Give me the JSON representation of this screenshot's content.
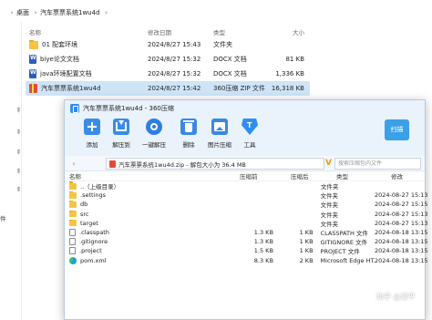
{
  "explorer": {
    "address": {
      "chevron": "›",
      "crumb1": "桌面",
      "crumb2": "汽车票票系统1wu4d"
    },
    "sidebar_fragments": [
      "",
      "",
      "",
      "",
      "",
      "件",
      "",
      "",
      "",
      "",
      "",
      "",
      "",
      "",
      ""
    ],
    "columns": {
      "name": "名称",
      "date": "修改日期",
      "type": "类型",
      "size": "大小"
    },
    "files": [
      {
        "name": "01 配套环境",
        "date": "2024/8/27 15:43",
        "type": "文件夹",
        "size": "",
        "icon": "folder-icon"
      },
      {
        "name": "biye论文文档",
        "date": "2024/8/27 15:32",
        "type": "DOCX 文档",
        "size": "81 KB",
        "icon": "docx-icon"
      },
      {
        "name": "java环境配置文档",
        "date": "2024/8/27 15:32",
        "type": "DOCX 文档",
        "size": "1,336 KB",
        "icon": "docx-icon"
      },
      {
        "name": "汽车票票系统1wu4d",
        "date": "2024/8/27 15:42",
        "type": "360压缩 ZIP 文件",
        "size": "16,318 KB",
        "icon": "zip-icon"
      }
    ]
  },
  "zip": {
    "title": "汽车票票系统1wu4d - 360压缩",
    "toolbar": [
      {
        "name": "add",
        "label": "添加",
        "icon": "add-icon"
      },
      {
        "name": "extract",
        "label": "解压到",
        "icon": "extract-icon"
      },
      {
        "name": "oneclick",
        "label": "一键解压",
        "icon": "one-click-extract-icon"
      },
      {
        "name": "delete",
        "label": "删除",
        "icon": "delete-icon"
      },
      {
        "name": "imgzip",
        "label": "图片压缩",
        "icon": "image-compress-icon"
      },
      {
        "name": "tools",
        "label": "工具",
        "icon": "tools-icon"
      }
    ],
    "badge": "扫描",
    "path": "汽车票票系统1wu4d.zip - 解包大小为 36.4 MB",
    "search_placeholder": "搜索压缩包内文件",
    "columns": {
      "name": "名称",
      "compressed": "压缩前",
      "original": "压缩后",
      "type": "类型",
      "modified": "修改"
    },
    "files": [
      {
        "name": "..（上级目录）",
        "compressed": "",
        "original": "",
        "type": "文件夹",
        "modified": "",
        "icon": "folder-icon"
      },
      {
        "name": ".settings",
        "compressed": "",
        "original": "",
        "type": "文件夹",
        "modified": "2024-08-27 15:13",
        "icon": "folder-icon"
      },
      {
        "name": "db",
        "compressed": "",
        "original": "",
        "type": "文件夹",
        "modified": "2024-08-27 15:15",
        "icon": "folder-icon"
      },
      {
        "name": "src",
        "compressed": "",
        "original": "",
        "type": "文件夹",
        "modified": "2024-08-27 15:13",
        "icon": "folder-icon"
      },
      {
        "name": "target",
        "compressed": "",
        "original": "",
        "type": "文件夹",
        "modified": "2024-08-27 15:13",
        "icon": "folder-icon"
      },
      {
        "name": ".classpath",
        "compressed": "1.3 KB",
        "original": "1 KB",
        "type": "CLASSPATH 文件",
        "modified": "2024-08-18 13:15",
        "icon": "file-icon"
      },
      {
        "name": ".gitignore",
        "compressed": "1.3 KB",
        "original": "1 KB",
        "type": "GITIGNORE 文件",
        "modified": "2024-08-18 13:15",
        "icon": "file-icon"
      },
      {
        "name": ".project",
        "compressed": "1.5 KB",
        "original": "1 KB",
        "type": "PROJECT 文件",
        "modified": "2024-08-18 13:15",
        "icon": "file-icon"
      },
      {
        "name": "pom.xml",
        "compressed": "8.3 KB",
        "original": "2 KB",
        "type": "Microsoft Edge HT...",
        "modified": "2024-08-18 13:15",
        "icon": "edge-icon"
      }
    ]
  },
  "watermark": "知乎 @清平"
}
